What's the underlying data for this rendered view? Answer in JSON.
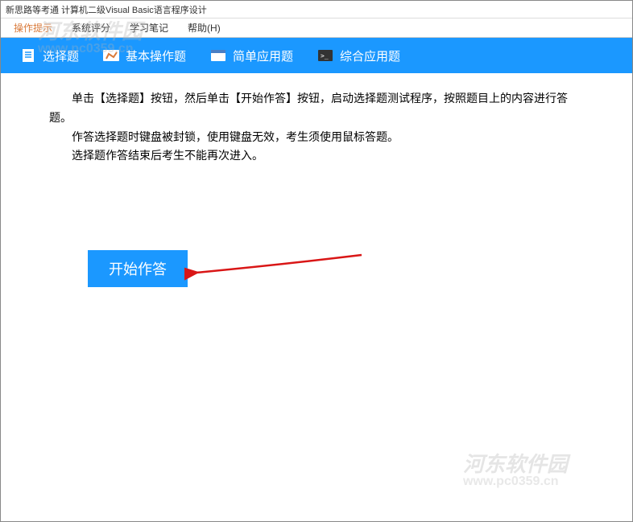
{
  "window": {
    "title": "新思路等考通 计算机二级Visual Basic语言程序设计"
  },
  "menu": {
    "items": [
      {
        "label": "操作提示",
        "highlighted": true
      },
      {
        "label": "系统评分",
        "highlighted": false
      },
      {
        "label": "学习笔记",
        "highlighted": false
      },
      {
        "label": "帮助(H)",
        "highlighted": false
      }
    ]
  },
  "tabs": {
    "items": [
      {
        "label": "选择题",
        "icon": "document-icon"
      },
      {
        "label": "基本操作题",
        "icon": "brush-icon"
      },
      {
        "label": "简单应用题",
        "icon": "app-icon"
      },
      {
        "label": "综合应用题",
        "icon": "terminal-icon"
      }
    ]
  },
  "content": {
    "line1": "单击【选择题】按钮，然后单击【开始作答】按钮，启动选择题测试程序，按照题目上的内容进行答题。",
    "line2": "作答选择题时键盘被封锁，使用键盘无效，考生须使用鼠标答题。",
    "line3": "选择题作答结束后考生不能再次进入。"
  },
  "buttons": {
    "start": "开始作答"
  },
  "watermark": {
    "text": "河东软件园",
    "url": "www.pc0359.cn"
  }
}
